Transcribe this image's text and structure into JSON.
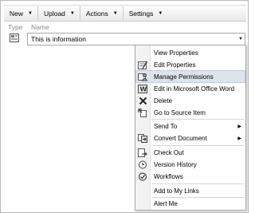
{
  "toolbar": {
    "new_label": "New",
    "upload_label": "Upload",
    "actions_label": "Actions",
    "settings_label": "Settings"
  },
  "list": {
    "col_type": "Type",
    "col_name": "Name",
    "row_name": "This is information"
  },
  "menu": {
    "items": [
      {
        "label": "View Properties",
        "icon": "none"
      },
      {
        "label": "Edit Properties",
        "icon": "edit-properties-icon"
      },
      {
        "label": "Manage Permissions",
        "icon": "permissions-icon"
      },
      {
        "label": "Edit in Microsoft Office Word",
        "icon": "word-icon"
      },
      {
        "label": "Delete",
        "icon": "delete-icon"
      },
      {
        "label": "Go to Source Item",
        "icon": "source-item-icon"
      },
      {
        "label": "Send To",
        "icon": "none"
      },
      {
        "label": "Convert Document",
        "icon": "convert-icon"
      },
      {
        "label": "Check Out",
        "icon": "check-out-icon"
      },
      {
        "label": "Version History",
        "icon": "version-history-icon"
      },
      {
        "label": "Workflows",
        "icon": "workflows-icon"
      },
      {
        "label": "Add to My Links",
        "icon": "none"
      },
      {
        "label": "Alert Me",
        "icon": "none"
      }
    ],
    "highlighted": "Manage Permissions"
  },
  "colors": {
    "highlight": "#dfe4ea",
    "border": "#a8a8a8"
  }
}
